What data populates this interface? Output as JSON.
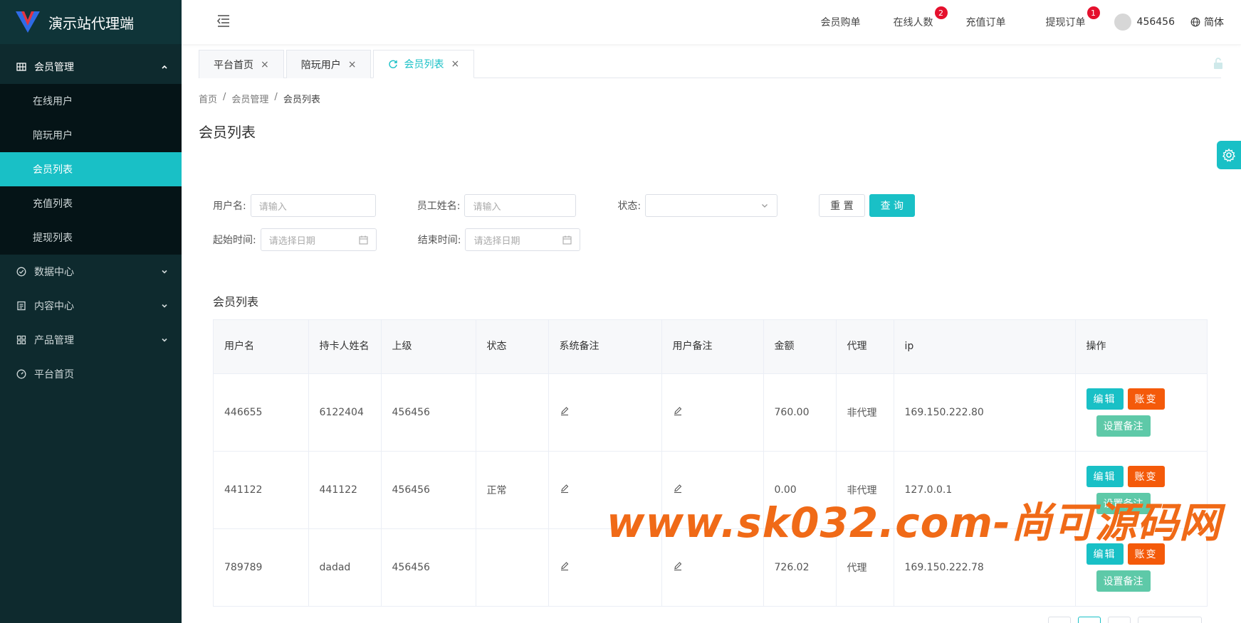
{
  "app": {
    "title": "演示站代理端"
  },
  "sidebar": {
    "groups": [
      {
        "label": "会员管理",
        "icon": "grid-icon",
        "expanded": true,
        "items": [
          {
            "label": "在线用户"
          },
          {
            "label": "陪玩用户"
          },
          {
            "label": "会员列表",
            "active": true
          },
          {
            "label": "充值列表"
          },
          {
            "label": "提现列表"
          }
        ]
      },
      {
        "label": "数据中心",
        "icon": "check-circle-icon"
      },
      {
        "label": "内容中心",
        "icon": "document-icon"
      },
      {
        "label": "产品管理",
        "icon": "apps-icon"
      },
      {
        "label": "平台首页",
        "icon": "dashboard-icon"
      }
    ]
  },
  "topnav": {
    "member_orders": "会员购单",
    "online_count": {
      "label": "在线人数",
      "badge": "2"
    },
    "recharge_orders": "充值订单",
    "withdraw_orders": {
      "label": "提现订单",
      "badge": "1"
    },
    "username": "456456",
    "language": "简体"
  },
  "tabs": [
    {
      "label": "平台首页"
    },
    {
      "label": "陪玩用户"
    },
    {
      "label": "会员列表",
      "active": true
    }
  ],
  "breadcrumb": {
    "home": "首页",
    "section": "会员管理",
    "current": "会员列表",
    "sep": "/"
  },
  "page": {
    "title": "会员列表"
  },
  "filters": {
    "username": {
      "label": "用户名:",
      "placeholder": "请输入"
    },
    "staff_name": {
      "label": "员工姓名:",
      "placeholder": "请输入"
    },
    "status": {
      "label": "状态:",
      "value": ""
    },
    "start_time": {
      "label": "起始时间:",
      "placeholder": "请选择日期"
    },
    "end_time": {
      "label": "结束时间:",
      "placeholder": "请选择日期"
    },
    "reset_label": "重 置",
    "search_label": "查 询"
  },
  "table": {
    "title": "会员列表",
    "columns": [
      "用户名",
      "持卡人姓名",
      "上级",
      "状态",
      "系统备注",
      "用户备注",
      "金额",
      "代理",
      "ip",
      "操作"
    ],
    "rows": [
      {
        "username": "446655",
        "cardholder": "6122404",
        "parent": "456456",
        "status": "",
        "amount": "760.00",
        "agent": "非代理",
        "ip": "169.150.222.80"
      },
      {
        "username": "441122",
        "cardholder": "441122",
        "parent": "456456",
        "status": "正常",
        "amount": "0.00",
        "agent": "非代理",
        "ip": "127.0.0.1"
      },
      {
        "username": "789789",
        "cardholder": "dadad",
        "parent": "456456",
        "status": "",
        "amount": "726.02",
        "agent": "代理",
        "ip": "169.150.222.78"
      }
    ],
    "actions": {
      "edit": "编辑",
      "change": "账变",
      "note": "设置备注"
    }
  },
  "watermark": "www.sk032.com-尚可源码网",
  "colors": {
    "accent": "#19c0c6",
    "sidebar_bg": "#0e2a2e",
    "danger": "#f45a0a",
    "badge": "#e5102d"
  }
}
